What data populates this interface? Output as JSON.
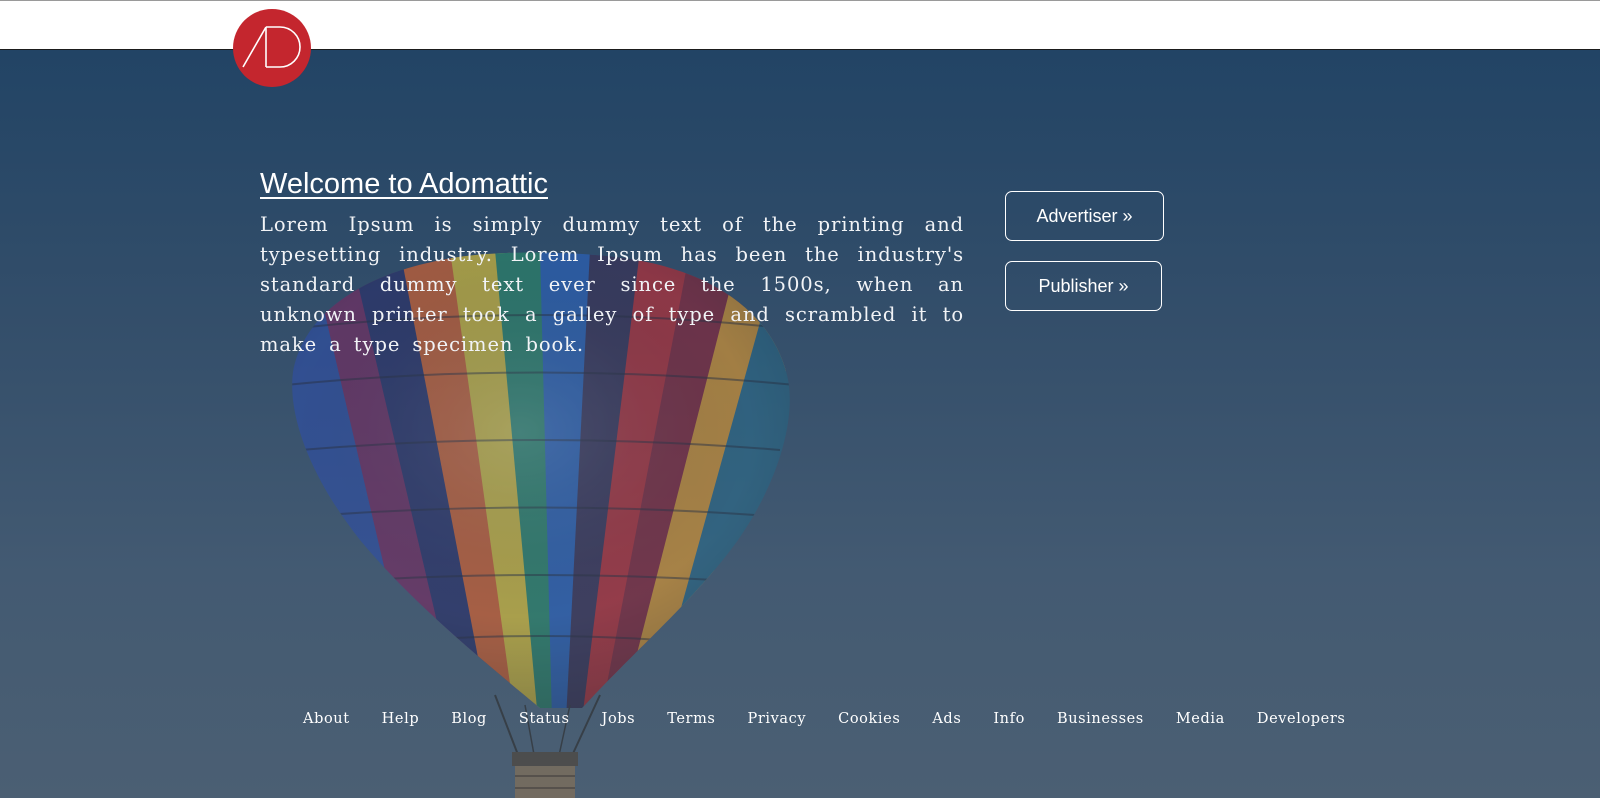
{
  "brand": {
    "logo_text": "AD",
    "logo_color": "#c4262e"
  },
  "hero": {
    "title": "Welcome to Adomattic",
    "body": "Lorem Ipsum is simply dummy text of the printing and typesetting industry. Lorem Ipsum has been the industry's standard dummy text ever since the 1500s, when an unknown printer took a galley of type and scrambled it to make a type specimen book.",
    "background_image": "hot-air-balloon"
  },
  "actions": {
    "advertiser_label": "Advertiser »",
    "publisher_label": "Publisher  »"
  },
  "footer": {
    "links": [
      "About",
      "Help",
      "Blog",
      "Status",
      "Jobs",
      "Terms",
      "Privacy",
      "Cookies",
      "Ads",
      "Info",
      "Businesses",
      "Media",
      "Developers"
    ]
  },
  "colors": {
    "header_bg": "#ffffff",
    "hero_bg_top": "#224465",
    "hero_bg_bottom": "#4b5f73",
    "text": "#ffffff"
  }
}
